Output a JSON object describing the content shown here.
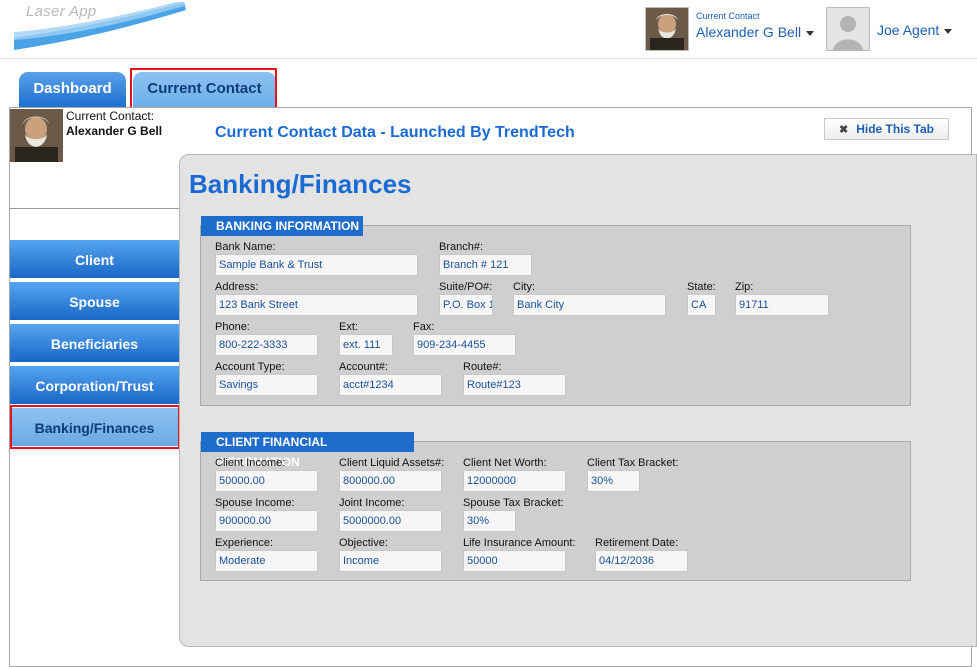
{
  "header": {
    "logo_text": "Laser App",
    "current_contact_label": "Current Contact",
    "current_contact_name": "Alexander G Bell",
    "agent_name": "Joe Agent"
  },
  "tabs": [
    {
      "label": "Dashboard"
    },
    {
      "label": "Current Contact"
    }
  ],
  "sidebar": {
    "contact_label": "Current Contact:",
    "contact_name": "Alexander G Bell",
    "items": [
      {
        "label": "Client"
      },
      {
        "label": "Spouse"
      },
      {
        "label": "Beneficiaries"
      },
      {
        "label": "Corporation/Trust"
      },
      {
        "label": "Banking/Finances",
        "active": true
      }
    ]
  },
  "content": {
    "title": "Current Contact Data - Launched By TrendTech",
    "hide_tab_label": "Hide This Tab",
    "section_title": "Banking/Finances"
  },
  "banking": {
    "header": "BANKING INFORMATION",
    "bank_name": {
      "label": "Bank Name:",
      "value": "Sample Bank & Trust"
    },
    "branch": {
      "label": "Branch#:",
      "value": "Branch # 121"
    },
    "address": {
      "label": "Address:",
      "value": "123 Bank Street"
    },
    "suite": {
      "label": "Suite/PO#:",
      "value": "P.O. Box 1"
    },
    "city": {
      "label": "City:",
      "value": "Bank City"
    },
    "state": {
      "label": "State:",
      "value": "CA"
    },
    "zip": {
      "label": "Zip:",
      "value": "91711"
    },
    "phone": {
      "label": "Phone:",
      "value": "800-222-3333"
    },
    "ext": {
      "label": "Ext:",
      "value": "ext. 111"
    },
    "fax": {
      "label": "Fax:",
      "value": "909-234-4455"
    },
    "account_type": {
      "label": "Account Type:",
      "value": "Savings"
    },
    "account": {
      "label": "Account#:",
      "value": "acct#1234"
    },
    "route": {
      "label": "Route#:",
      "value": "Route#123"
    }
  },
  "financial": {
    "header": "CLIENT FINANCIAL INFORMATION",
    "client_income": {
      "label": "Client Income:",
      "value": "50000.00"
    },
    "client_liquid": {
      "label": "Client Liquid Assets#:",
      "value": "800000.00"
    },
    "client_net": {
      "label": "Client Net Worth:",
      "value": "12000000"
    },
    "client_tax": {
      "label": "Client Tax Bracket:",
      "value": "30%"
    },
    "spouse_income": {
      "label": "Spouse Income:",
      "value": "900000.00"
    },
    "joint_income": {
      "label": "Joint Income:",
      "value": "5000000.00"
    },
    "spouse_tax": {
      "label": "Spouse Tax Bracket:",
      "value": "30%"
    },
    "experience": {
      "label": "Experience:",
      "value": "Moderate"
    },
    "objective": {
      "label": "Objective:",
      "value": "Income"
    },
    "life_insurance": {
      "label": "Life Insurance Amount:",
      "value": "50000"
    },
    "retirement": {
      "label": "Retirement Date:",
      "value": "04/12/2036"
    }
  }
}
